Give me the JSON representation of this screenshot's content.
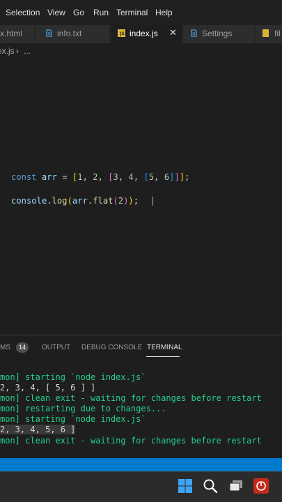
{
  "menu": [
    "Selection",
    "View",
    "Go",
    "Run",
    "Terminal",
    "Help"
  ],
  "tabs": [
    {
      "label": "x.html",
      "active": false
    },
    {
      "label": "info.txt",
      "active": false
    },
    {
      "label": "index.js",
      "active": true,
      "badge": "JS"
    },
    {
      "label": "Settings",
      "active": false
    },
    {
      "label": "fil",
      "active": false
    }
  ],
  "breadcrumb": {
    "file": "ex.js",
    "sep": "›",
    "symbol": "..."
  },
  "code": {
    "line1": {
      "kw": "const",
      "name": "arr",
      "eq": " = ",
      "open1": "[",
      "n1": "1",
      "c1": ", ",
      "n2": "2",
      "c2": ", ",
      "open2": "[",
      "n3": "3",
      "c3": ", ",
      "n4": "4",
      "c4": ", ",
      "open3": "[",
      "n5": "5",
      "c5": ", ",
      "n6": "6",
      "close3": "]",
      "close2": "]",
      "close1": "]",
      "semi": ";"
    },
    "line2": {
      "obj": "console",
      "dot1": ".",
      "fn1": "log",
      "p1": "(",
      "arg": "arr",
      "dot2": ".",
      "fn2": "flat",
      "p2": "(",
      "num": "2",
      "p3": ")",
      "p4": ")",
      "semi": ";"
    }
  },
  "panel": {
    "tabs": {
      "problems": "MS",
      "problems_count": "14",
      "output": "OUTPUT",
      "debug": "DEBUG CONSOLE",
      "terminal": "TERMINAL"
    },
    "lines": [
      "mon] starting `node index.js`",
      "2, 3, 4, [ 5, 6 ] ]",
      "mon] clean exit - waiting for changes before restart",
      "mon] restarting due to changes...",
      "mon] starting `node index.js`",
      "2, 3, 4, 5, 6 ]",
      "mon] clean exit - waiting for changes before restart"
    ]
  },
  "colors": {
    "accent": "#007acc",
    "terminal_green": "#23d18b",
    "js_badge": "#d7b43a"
  }
}
